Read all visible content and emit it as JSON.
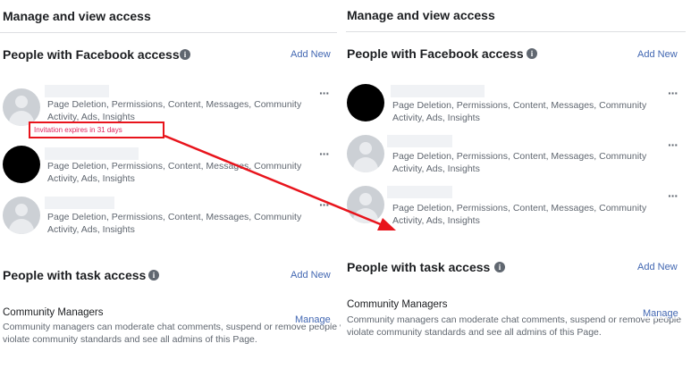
{
  "left": {
    "heading": "Manage and view access",
    "facebook_access": {
      "title": "People with Facebook access",
      "add_new": "Add New",
      "people": [
        {
          "permissions": "Page Deletion, Permissions, Content, Messages, Community Activity, Ads, Insights",
          "status": "Invitation expires in 31 days",
          "menu": "···"
        },
        {
          "permissions": "Page Deletion, Permissions, Content, Messages, Community Activity, Ads, Insights",
          "menu": "···"
        },
        {
          "permissions": "Page Deletion, Permissions, Content, Messages, Community Activity, Ads, Insights",
          "menu": "···"
        }
      ]
    },
    "task_access": {
      "title": "People with task access",
      "add_new": "Add New",
      "role_title": "Community Managers",
      "role_desc_1": "Community managers can moderate chat comments, suspend or remove people v",
      "role_desc_2": "violate community standards and see all admins of this Page.",
      "manage": "Manage"
    }
  },
  "right": {
    "heading": "Manage and view access",
    "facebook_access": {
      "title": "People with Facebook access",
      "add_new": "Add New",
      "people": [
        {
          "permissions": "Page Deletion, Permissions, Content, Messages, Community Activity, Ads, Insights",
          "menu": "···"
        },
        {
          "permissions": "Page Deletion, Permissions, Content, Messages, Community Activity, Ads, Insights",
          "menu": "···"
        },
        {
          "permissions": "Page Deletion, Permissions, Content, Messages, Community Activity, Ads, Insights",
          "menu": "···"
        }
      ]
    },
    "task_access": {
      "title": "People with task access",
      "add_new": "Add New",
      "role_title": "Community Managers",
      "role_desc_1": "Community managers can moderate chat comments, suspend or remove people",
      "role_desc_2": "violate community standards and see all admins of this Page.",
      "manage": "Manage"
    }
  },
  "annotation": {
    "color": "#e8141c"
  },
  "info_icon": "i"
}
